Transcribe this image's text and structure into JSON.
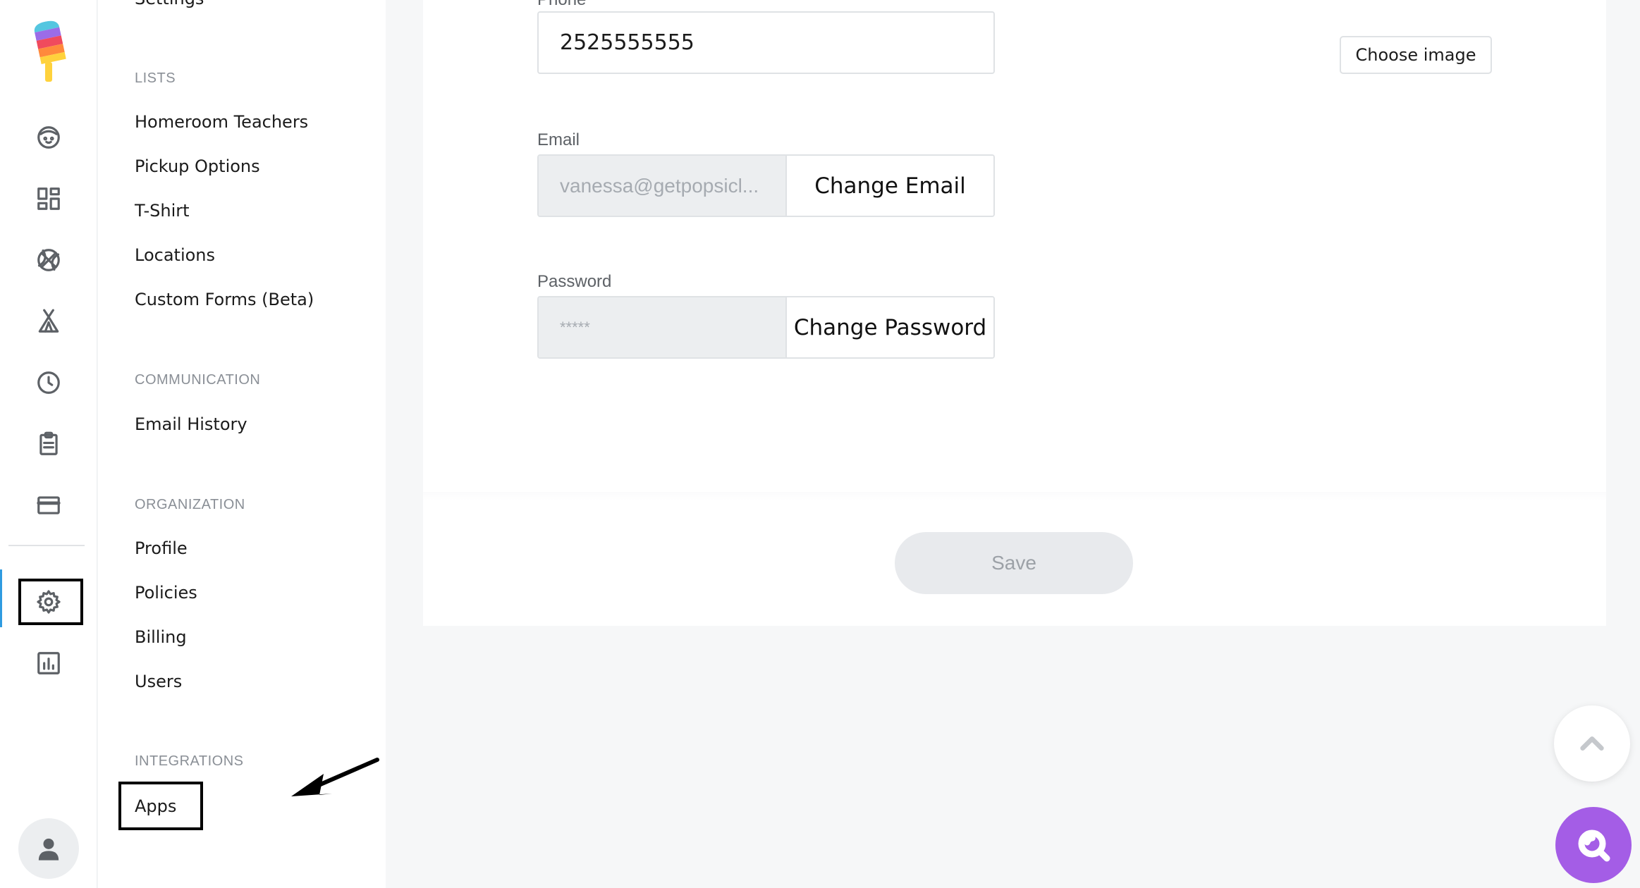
{
  "nav": {
    "partial_top_label": "Settings",
    "sections": [
      {
        "heading": "LISTS",
        "items": [
          "Homeroom Teachers",
          "Pickup Options",
          "T-Shirt",
          "Locations",
          "Custom Forms (Beta)"
        ]
      },
      {
        "heading": "COMMUNICATION",
        "items": [
          "Email History"
        ]
      },
      {
        "heading": "ORGANIZATION",
        "items": [
          "Profile",
          "Policies",
          "Billing",
          "Users"
        ]
      },
      {
        "heading": "INTEGRATIONS",
        "items": [
          "Apps"
        ]
      }
    ]
  },
  "rail": {
    "icons": [
      "logo-icon",
      "child-face-icon",
      "dashboard-icon",
      "sports-ball-icon",
      "camp-tent-icon",
      "clock-icon",
      "clipboard-icon",
      "credit-card-icon",
      "gear-icon",
      "report-chart-icon",
      "user-avatar-icon"
    ],
    "active": "gear-icon"
  },
  "form": {
    "phone_label": "Phone",
    "phone_value": "2525555555",
    "choose_image_label": "Choose image",
    "email_label": "Email",
    "email_value": "vanessa@getpopsicl...",
    "change_email_label": "Change Email",
    "password_label": "Password",
    "password_value": "*****",
    "change_password_label": "Change Password",
    "save_label": "Save"
  },
  "colors": {
    "accent_purple": "#a45de6",
    "active_indicator": "#2f9be0"
  }
}
